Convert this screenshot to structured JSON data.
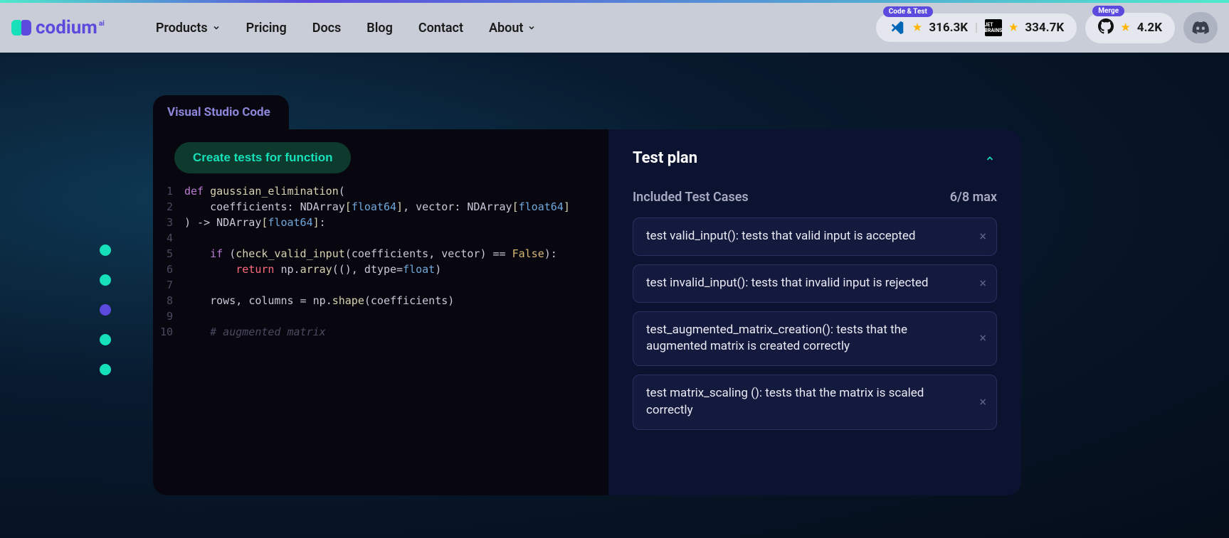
{
  "header": {
    "brand": "codium",
    "brand_suffix": "ai",
    "nav": [
      "Products",
      "Pricing",
      "Docs",
      "Blog",
      "Contact",
      "About"
    ],
    "stats": {
      "code_test_badge": "Code & Test",
      "vscode_count": "316.3K",
      "jetbrains_count": "334.7K",
      "merge_badge": "Merge",
      "github_count": "4.2K"
    }
  },
  "stage": {
    "tab_label": "Visual Studio Code",
    "create_btn": "Create tests for function",
    "code": {
      "lines": [
        {
          "n": "1",
          "seg": [
            [
              "kw",
              "def "
            ],
            [
              "fn",
              "gaussian_elimination"
            ],
            [
              "punct",
              "("
            ]
          ]
        },
        {
          "n": "2",
          "seg": [
            [
              "param",
              "    coefficients"
            ],
            [
              "punct",
              ": "
            ],
            [
              "type",
              "NDArray"
            ],
            [
              "typebrk",
              "["
            ],
            [
              "typename",
              "float64"
            ],
            [
              "typebrk",
              "]"
            ],
            [
              "punct",
              ", "
            ],
            [
              "param",
              "vector"
            ],
            [
              "punct",
              ": "
            ],
            [
              "type",
              "NDArray"
            ],
            [
              "typebrk",
              "["
            ],
            [
              "typename",
              "float64"
            ],
            [
              "typebrk",
              "]"
            ]
          ]
        },
        {
          "n": "3",
          "seg": [
            [
              "punct",
              ") -> "
            ],
            [
              "type",
              "NDArray"
            ],
            [
              "typebrk",
              "["
            ],
            [
              "typename",
              "float64"
            ],
            [
              "typebrk",
              "]"
            ],
            [
              "punct",
              ":"
            ]
          ]
        },
        {
          "n": "4",
          "seg": [
            [
              "",
              ""
            ]
          ]
        },
        {
          "n": "5",
          "seg": [
            [
              "kw",
              "    if "
            ],
            [
              "punct",
              "("
            ],
            [
              "fn",
              "check_valid_input"
            ],
            [
              "punct",
              "("
            ],
            [
              "param",
              "coefficients"
            ],
            [
              "punct",
              ", "
            ],
            [
              "param",
              "vector"
            ],
            [
              "punct",
              ") "
            ],
            [
              "eq",
              "== "
            ],
            [
              "num-false",
              "False"
            ],
            [
              "punct",
              "):"
            ]
          ]
        },
        {
          "n": "6",
          "seg": [
            [
              "ret",
              "        return "
            ],
            [
              "param",
              "np"
            ],
            [
              "punct",
              "."
            ],
            [
              "attr",
              "array"
            ],
            [
              "punct",
              "(("
            ],
            [
              "punct",
              "), "
            ],
            [
              "param",
              "dtype"
            ],
            [
              "eq",
              "="
            ],
            [
              "typename",
              "float"
            ],
            [
              "punct",
              ")"
            ]
          ]
        },
        {
          "n": "7",
          "seg": [
            [
              "",
              ""
            ]
          ]
        },
        {
          "n": "8",
          "seg": [
            [
              "param",
              "    rows"
            ],
            [
              "punct",
              ", "
            ],
            [
              "param",
              "columns"
            ],
            [
              "eq",
              " = "
            ],
            [
              "param",
              "np"
            ],
            [
              "punct",
              "."
            ],
            [
              "attr",
              "shape"
            ],
            [
              "punct",
              "("
            ],
            [
              "param",
              "coefficients"
            ],
            [
              "punct",
              ")"
            ]
          ]
        },
        {
          "n": "9",
          "seg": [
            [
              "",
              ""
            ]
          ]
        },
        {
          "n": "10",
          "seg": [
            [
              "comment",
              "    # augmented matrix"
            ]
          ]
        }
      ]
    }
  },
  "plan": {
    "title": "Test plan",
    "subtitle": "Included Test Cases",
    "counter": "6/8 max",
    "cases": [
      "test valid_input(): tests that valid input is accepted",
      "test invalid_input(): tests that invalid input is rejected",
      "test_augmented_matrix_creation(): tests that the augmented matrix is created correctly",
      "test matrix_scaling (): tests that the matrix is scaled correctly"
    ]
  }
}
